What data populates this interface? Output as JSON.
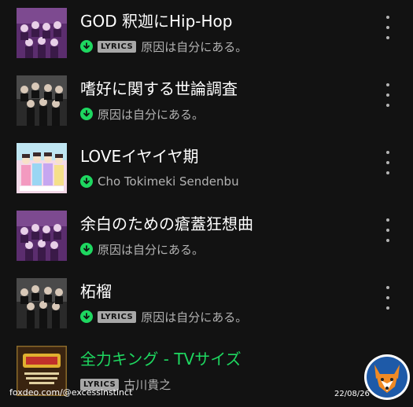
{
  "tracks": [
    {
      "title": "GOD 釈迦にHip-Hop",
      "artist": "原因は自分にある。",
      "downloaded": true,
      "lyrics": true,
      "playing": false,
      "art": "purple-group"
    },
    {
      "title": "嗜好に関する世論調査",
      "artist": "原因は自分にある。",
      "downloaded": true,
      "lyrics": false,
      "playing": false,
      "art": "dark-group"
    },
    {
      "title": "LOVEイヤイヤ期",
      "artist": "Cho Tokimeki Sendenbu",
      "downloaded": true,
      "lyrics": false,
      "playing": false,
      "art": "pastel-group"
    },
    {
      "title": "余白のための瘡蓋狂想曲",
      "artist": "原因は自分にある。",
      "downloaded": true,
      "lyrics": false,
      "playing": false,
      "art": "purple-group"
    },
    {
      "title": "柘榴",
      "artist": "原因は自分にある。",
      "downloaded": true,
      "lyrics": true,
      "playing": false,
      "art": "dark-group"
    },
    {
      "title": "全力キング - TVサイズ",
      "artist": "古川貴之",
      "downloaded": false,
      "lyrics": true,
      "playing": true,
      "art": "gold-logo"
    }
  ],
  "lyrics_badge": "LYRICS",
  "watermark": "foxdeo.com/@excessinstinct",
  "date": "22/08/26",
  "colors": {
    "accent": "#1ed760",
    "background": "#121212",
    "secondary_text": "#b3b3b3"
  }
}
